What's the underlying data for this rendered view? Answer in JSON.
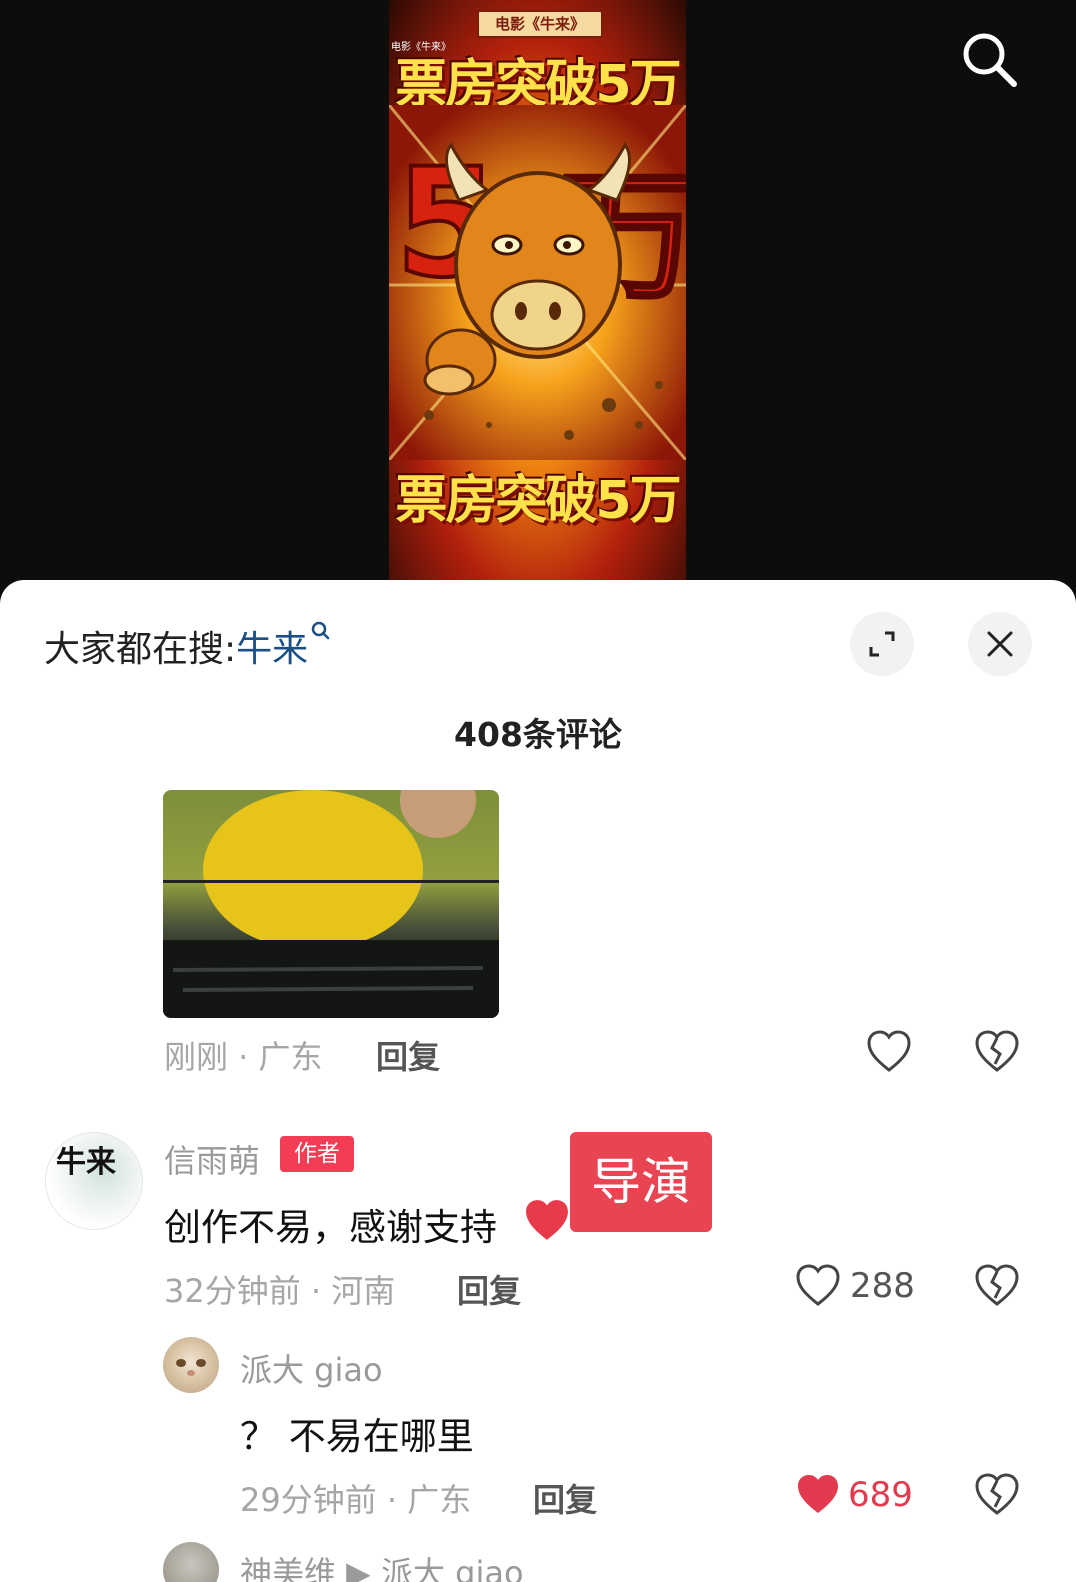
{
  "poster": {
    "banner": "电影《牛来》",
    "small_caption": "电影《牛来》",
    "headline_top": "票房突破5万",
    "headline_bottom": "票房突破5万"
  },
  "search_bar": {
    "prefix": "大家都在搜:",
    "keyword": "牛来"
  },
  "comments_header": {
    "count_title": "408条评论"
  },
  "comment_image_post": {
    "time_location": "刚刚 · 广东",
    "reply_label": "回复"
  },
  "author_comment": {
    "avatar_text": "牛来",
    "username": "信雨萌",
    "author_tag": "作者",
    "text": "创作不易，感谢支持",
    "overlay_label": "导演",
    "time_location": "32分钟前 · 河南",
    "reply_label": "回复",
    "like_count": "288"
  },
  "reply_comment": {
    "username": "派大 giao",
    "text": "？ 不易在哪里",
    "time_location": "29分钟前 · 广东",
    "reply_label": "回复",
    "like_count": "689",
    "liked": true
  },
  "next_reply": {
    "username_partial": "神美维 ▶ 派大 giao"
  },
  "colors": {
    "accent_red": "#e23a4f",
    "keyword_blue": "#1b4f86",
    "author_tag": "#f23d55"
  },
  "icons": [
    "search-icon",
    "search-mini-icon",
    "expand-icon",
    "close-icon",
    "heart-outline-icon",
    "heart-filled-icon",
    "broken-heart-icon"
  ]
}
